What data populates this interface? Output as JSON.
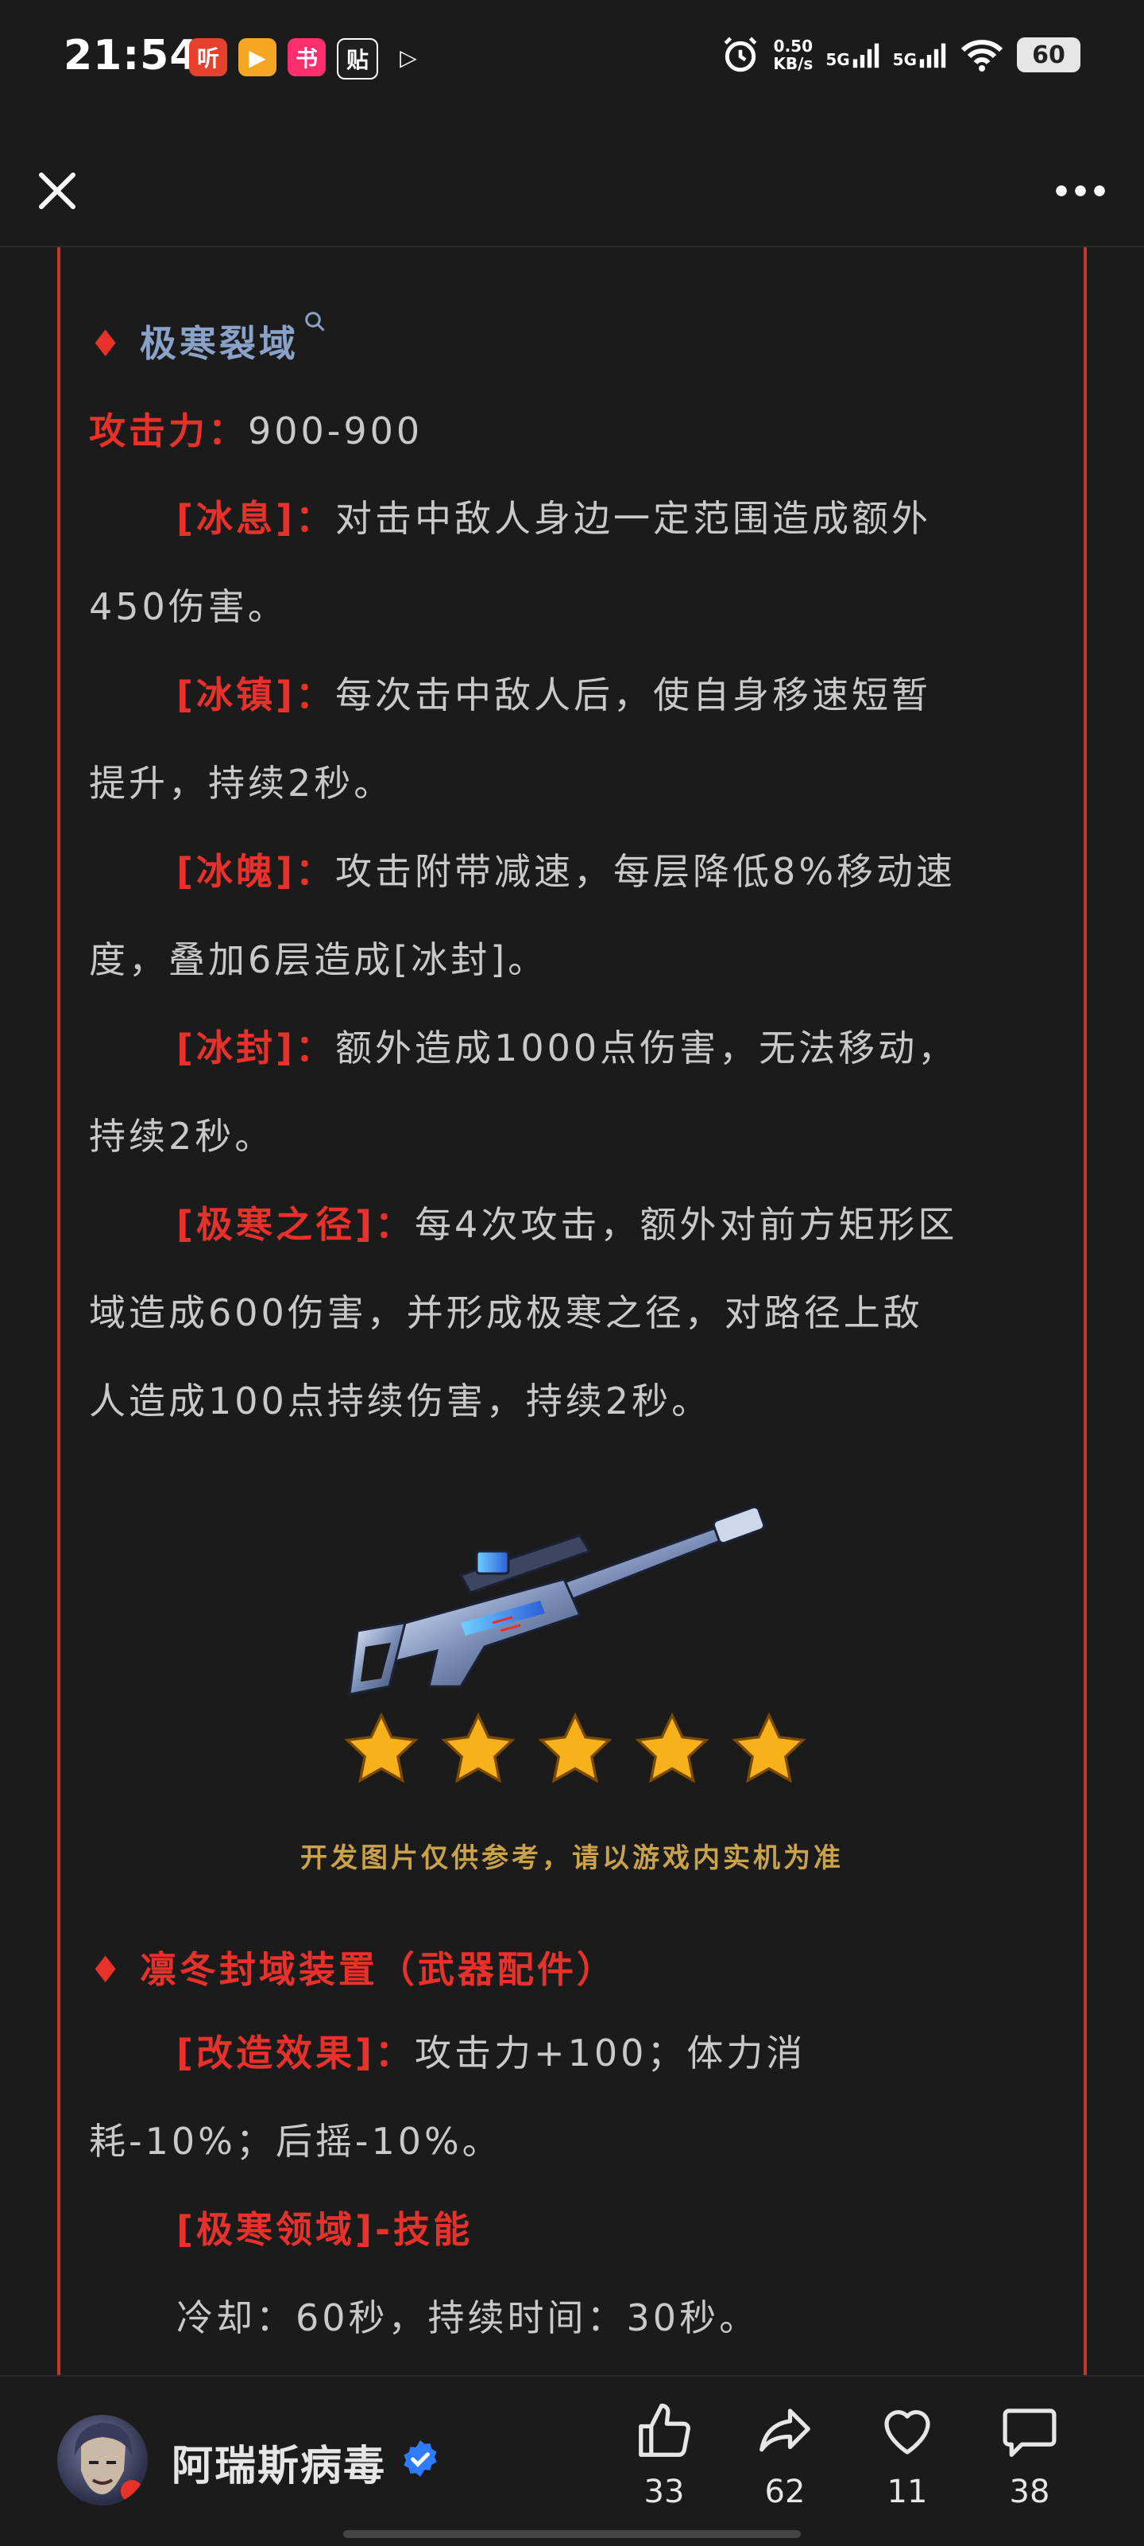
{
  "status_bar": {
    "time": "21:54",
    "apps": [
      {
        "label": "听",
        "bg": "#e5412d"
      },
      {
        "label": "▶",
        "bg": "#f5a623"
      },
      {
        "label": "书",
        "bg": "#ff2f6d"
      },
      {
        "label": "贴",
        "bg": "#1f1f1f"
      },
      {
        "label": "▷",
        "bg": "#1b1b1b"
      }
    ],
    "net_speed": "0.50",
    "net_unit": "KB/s",
    "sim1": "5G",
    "sim2": "5G",
    "battery": "60"
  },
  "article": {
    "section1_title": "极寒裂域",
    "attack_label": "攻击力：",
    "attack_value": "900-900",
    "skills": [
      {
        "name": "[冰息]：",
        "desc_line1": "对击中敌人身边一定范围造成额外",
        "desc_line2": "450伤害。"
      },
      {
        "name": "[冰镇]：",
        "desc_line1": "每次击中敌人后，使自身移速短暂",
        "desc_line2": "提升，持续2秒。"
      },
      {
        "name": "[冰魄]：",
        "desc_line1": "攻击附带减速，每层降低8%移动速",
        "desc_line2": "度，叠加6层造成[冰封]。"
      },
      {
        "name": "[冰封]：",
        "desc_line1": "额外造成1000点伤害，无法移动，",
        "desc_line2": "持续2秒。"
      },
      {
        "name": "[极寒之径]：",
        "desc_line1": "每4次攻击，额外对前方矩形区",
        "desc_line2": "域造成600伤害，并形成极寒之径，对路径上敌",
        "desc_line3": "人造成100点持续伤害，持续2秒。"
      }
    ],
    "image_caption": "开发图片仅供参考，请以游戏内实机为准",
    "star_count": 5,
    "section2_title": "凛冬封域装置（武器配件）",
    "mod_effect_name": "[改造效果]：",
    "mod_effect_line1": "攻击力+100；体力消",
    "mod_effect_line2": "耗-10%；后摇-10%。",
    "skill_title": "[极寒领域]-技能",
    "skill_cooldown": "冷却：60秒，持续时间：30秒。"
  },
  "bottom_bar": {
    "author": "阿瑞斯病毒",
    "like_count": "33",
    "share_count": "62",
    "favorite_count": "11",
    "comment_count": "38"
  },
  "colors": {
    "accent_red": "#e8312a",
    "title_blue": "#8aa2c8",
    "caption_gold": "#c9a24a",
    "background": "#1b1b1b"
  }
}
